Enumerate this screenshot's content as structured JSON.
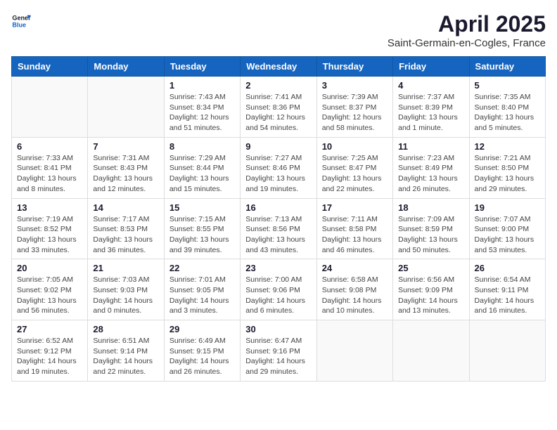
{
  "logo": {
    "text_general": "General",
    "text_blue": "Blue"
  },
  "title": "April 2025",
  "subtitle": "Saint-Germain-en-Cogles, France",
  "days_of_week": [
    "Sunday",
    "Monday",
    "Tuesday",
    "Wednesday",
    "Thursday",
    "Friday",
    "Saturday"
  ],
  "weeks": [
    [
      {
        "day": "",
        "info": ""
      },
      {
        "day": "",
        "info": ""
      },
      {
        "day": "1",
        "info": "Sunrise: 7:43 AM\nSunset: 8:34 PM\nDaylight: 12 hours and 51 minutes."
      },
      {
        "day": "2",
        "info": "Sunrise: 7:41 AM\nSunset: 8:36 PM\nDaylight: 12 hours and 54 minutes."
      },
      {
        "day": "3",
        "info": "Sunrise: 7:39 AM\nSunset: 8:37 PM\nDaylight: 12 hours and 58 minutes."
      },
      {
        "day": "4",
        "info": "Sunrise: 7:37 AM\nSunset: 8:39 PM\nDaylight: 13 hours and 1 minute."
      },
      {
        "day": "5",
        "info": "Sunrise: 7:35 AM\nSunset: 8:40 PM\nDaylight: 13 hours and 5 minutes."
      }
    ],
    [
      {
        "day": "6",
        "info": "Sunrise: 7:33 AM\nSunset: 8:41 PM\nDaylight: 13 hours and 8 minutes."
      },
      {
        "day": "7",
        "info": "Sunrise: 7:31 AM\nSunset: 8:43 PM\nDaylight: 13 hours and 12 minutes."
      },
      {
        "day": "8",
        "info": "Sunrise: 7:29 AM\nSunset: 8:44 PM\nDaylight: 13 hours and 15 minutes."
      },
      {
        "day": "9",
        "info": "Sunrise: 7:27 AM\nSunset: 8:46 PM\nDaylight: 13 hours and 19 minutes."
      },
      {
        "day": "10",
        "info": "Sunrise: 7:25 AM\nSunset: 8:47 PM\nDaylight: 13 hours and 22 minutes."
      },
      {
        "day": "11",
        "info": "Sunrise: 7:23 AM\nSunset: 8:49 PM\nDaylight: 13 hours and 26 minutes."
      },
      {
        "day": "12",
        "info": "Sunrise: 7:21 AM\nSunset: 8:50 PM\nDaylight: 13 hours and 29 minutes."
      }
    ],
    [
      {
        "day": "13",
        "info": "Sunrise: 7:19 AM\nSunset: 8:52 PM\nDaylight: 13 hours and 33 minutes."
      },
      {
        "day": "14",
        "info": "Sunrise: 7:17 AM\nSunset: 8:53 PM\nDaylight: 13 hours and 36 minutes."
      },
      {
        "day": "15",
        "info": "Sunrise: 7:15 AM\nSunset: 8:55 PM\nDaylight: 13 hours and 39 minutes."
      },
      {
        "day": "16",
        "info": "Sunrise: 7:13 AM\nSunset: 8:56 PM\nDaylight: 13 hours and 43 minutes."
      },
      {
        "day": "17",
        "info": "Sunrise: 7:11 AM\nSunset: 8:58 PM\nDaylight: 13 hours and 46 minutes."
      },
      {
        "day": "18",
        "info": "Sunrise: 7:09 AM\nSunset: 8:59 PM\nDaylight: 13 hours and 50 minutes."
      },
      {
        "day": "19",
        "info": "Sunrise: 7:07 AM\nSunset: 9:00 PM\nDaylight: 13 hours and 53 minutes."
      }
    ],
    [
      {
        "day": "20",
        "info": "Sunrise: 7:05 AM\nSunset: 9:02 PM\nDaylight: 13 hours and 56 minutes."
      },
      {
        "day": "21",
        "info": "Sunrise: 7:03 AM\nSunset: 9:03 PM\nDaylight: 14 hours and 0 minutes."
      },
      {
        "day": "22",
        "info": "Sunrise: 7:01 AM\nSunset: 9:05 PM\nDaylight: 14 hours and 3 minutes."
      },
      {
        "day": "23",
        "info": "Sunrise: 7:00 AM\nSunset: 9:06 PM\nDaylight: 14 hours and 6 minutes."
      },
      {
        "day": "24",
        "info": "Sunrise: 6:58 AM\nSunset: 9:08 PM\nDaylight: 14 hours and 10 minutes."
      },
      {
        "day": "25",
        "info": "Sunrise: 6:56 AM\nSunset: 9:09 PM\nDaylight: 14 hours and 13 minutes."
      },
      {
        "day": "26",
        "info": "Sunrise: 6:54 AM\nSunset: 9:11 PM\nDaylight: 14 hours and 16 minutes."
      }
    ],
    [
      {
        "day": "27",
        "info": "Sunrise: 6:52 AM\nSunset: 9:12 PM\nDaylight: 14 hours and 19 minutes."
      },
      {
        "day": "28",
        "info": "Sunrise: 6:51 AM\nSunset: 9:14 PM\nDaylight: 14 hours and 22 minutes."
      },
      {
        "day": "29",
        "info": "Sunrise: 6:49 AM\nSunset: 9:15 PM\nDaylight: 14 hours and 26 minutes."
      },
      {
        "day": "30",
        "info": "Sunrise: 6:47 AM\nSunset: 9:16 PM\nDaylight: 14 hours and 29 minutes."
      },
      {
        "day": "",
        "info": ""
      },
      {
        "day": "",
        "info": ""
      },
      {
        "day": "",
        "info": ""
      }
    ]
  ]
}
